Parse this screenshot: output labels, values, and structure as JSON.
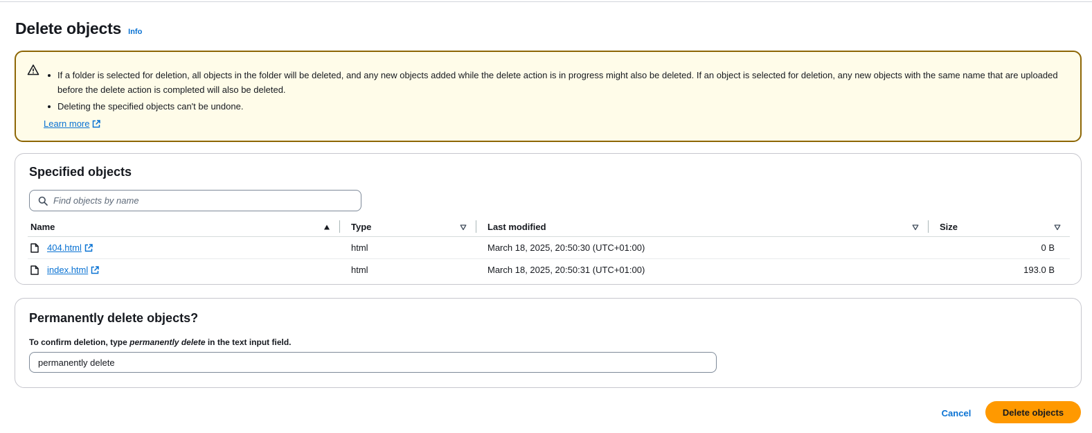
{
  "header": {
    "title": "Delete objects",
    "info_label": "Info"
  },
  "alert": {
    "icon": "warning-icon",
    "items": [
      "If a folder is selected for deletion, all objects in the folder will be deleted, and any new objects added while the delete action is in progress might also be deleted. If an object is selected for deletion, any new objects with the same name that are uploaded before the delete action is completed will also be deleted.",
      "Deleting the specified objects can't be undone."
    ],
    "learn_more": "Learn more"
  },
  "objects": {
    "title": "Specified objects",
    "search_placeholder": "Find objects by name",
    "columns": {
      "name": "Name",
      "type": "Type",
      "last_modified": "Last modified",
      "size": "Size"
    },
    "rows": [
      {
        "name": "404.html",
        "type": "html",
        "last_modified": "March 18, 2025, 20:50:30 (UTC+01:00)",
        "size": "0 B"
      },
      {
        "name": "index.html",
        "type": "html",
        "last_modified": "March 18, 2025, 20:50:31 (UTC+01:00)",
        "size": "193.0 B"
      }
    ]
  },
  "permanent": {
    "title": "Permanently delete objects?",
    "label_prefix": "To confirm deletion, type ",
    "label_emphasis": "permanently delete",
    "label_suffix": " in the text input field.",
    "input_value": "permanently delete"
  },
  "actions": {
    "cancel_label": "Cancel",
    "delete_label": "Delete objects"
  },
  "colors": {
    "link": "#0972d3",
    "warning_border": "#8d6605",
    "warning_bg": "#fffce9",
    "primary_button": "#ff9900"
  }
}
